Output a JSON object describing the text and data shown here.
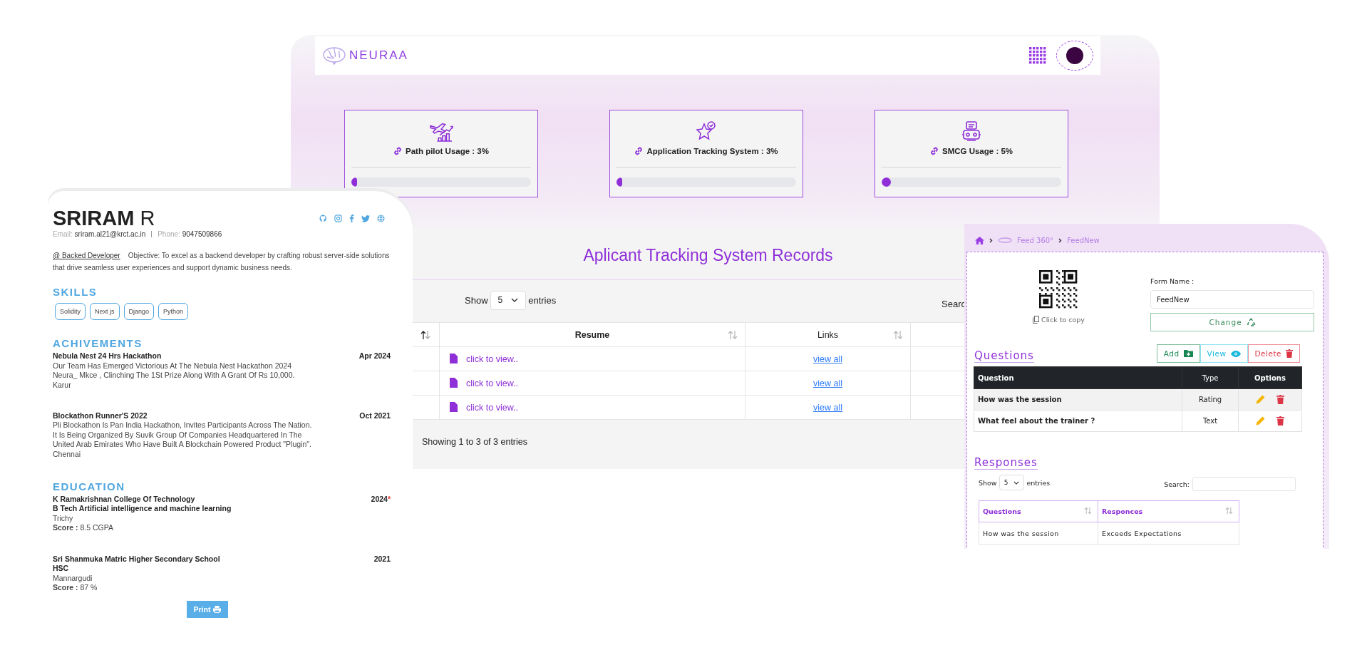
{
  "dashboard": {
    "brand": "NEURAA",
    "usage_cards": [
      {
        "kind": "plane",
        "label": "Path pilot Usage : 3%",
        "level": 0.03
      },
      {
        "kind": "star",
        "label": "Application Tracking System : 3%",
        "level": 0.03
      },
      {
        "kind": "robot",
        "label": "SMCG Usage : 5%",
        "level": 0.05
      }
    ],
    "records": {
      "title": "Aplicant Tracking System Records",
      "show_label": "Show",
      "page_size": "5",
      "entries_label": "entries",
      "search_label": "Searc",
      "columns": [
        "Resume",
        "Links"
      ],
      "rows": [
        {
          "resume": "click to view..",
          "links": "view all"
        },
        {
          "resume": "click to view..",
          "links": "view all"
        },
        {
          "resume": "click to view..",
          "links": "view all"
        }
      ],
      "info": "Showing 1 to 3 of 3 entries"
    }
  },
  "resume": {
    "first_name": "SRIRAM",
    "last_name": "R",
    "email_label": "Email:",
    "email": "sriram.al21@krct.ac.in",
    "phone_label": "Phone:",
    "phone": "9047509866",
    "role": "@ Backed Developer",
    "objective": "Objective: To excel as a backend developer by crafting robust server-side solutions that drive seamless user experiences and support dynamic business needs.",
    "skills_heading": "SKILLS",
    "skills": [
      "Solidity",
      "Next js",
      "Django",
      "Python"
    ],
    "achievements_heading": "ACHIVEMENTS",
    "achievements": [
      {
        "title": "Nebula Nest 24 Hrs Hackathon",
        "date": "Apr 2024",
        "description": "Our Team Has Emerged Victorious At The Nebula Nest Hackathon 2024 Neura_ Mkce , Clinching The 1St Prize Along With A Grant Of Rs 10,000.",
        "place": "Karur"
      },
      {
        "title": "Blockathon Runner'S 2022",
        "date": "Oct 2021",
        "description": "Pli Blockathon Is Pan India Hackathon, Invites Participants Across The Nation. It Is Being Organized By Suvik Group Of Companies Headquartered In The United Arab Emirates Who Have Built A Blockchain Powered Product \"Plugin\".",
        "place": "Chennai"
      }
    ],
    "education_heading": "EDUCATION",
    "education": [
      {
        "institution": "K Ramakrishnan College Of Technology",
        "year": "2024",
        "year_note": "*",
        "degree": "B Tech Artificial intelligence and machine learning",
        "place": "Trichy",
        "score_label": "Score :",
        "score": "8.5 CGPA"
      },
      {
        "institution": "Sri Shanmuka Matric Higher Secondary School",
        "year": "2021",
        "degree": "HSC",
        "place": "Mannargudi",
        "score_label": "Score :",
        "score": "87 %"
      }
    ],
    "print_button": "Print"
  },
  "feedback": {
    "breadcrumb": [
      "Feed 360°",
      "FeedNew"
    ],
    "copy_label": "Click to copy",
    "form_name_label": "Form Name :",
    "form_name": "FeedNew",
    "change_button": "Change",
    "questions_heading": "Questions",
    "actions": [
      {
        "kind": "add",
        "label": "Add"
      },
      {
        "kind": "view",
        "label": "View"
      },
      {
        "kind": "delete",
        "label": "Delete"
      }
    ],
    "question_columns": [
      "Question",
      "Type",
      "Options"
    ],
    "questions": [
      {
        "question": "How was the session",
        "type": "Rating"
      },
      {
        "question": "What feel about the trainer ?",
        "type": "Text"
      }
    ],
    "responses_heading": "Responses",
    "show_label": "Show",
    "page_size": "5",
    "entries_label": "entries",
    "search_label": "Search:",
    "response_columns": [
      "Questions",
      "Responces"
    ],
    "responses": [
      {
        "question": "How was the session",
        "response": "Exceeds Expectations"
      }
    ]
  }
}
